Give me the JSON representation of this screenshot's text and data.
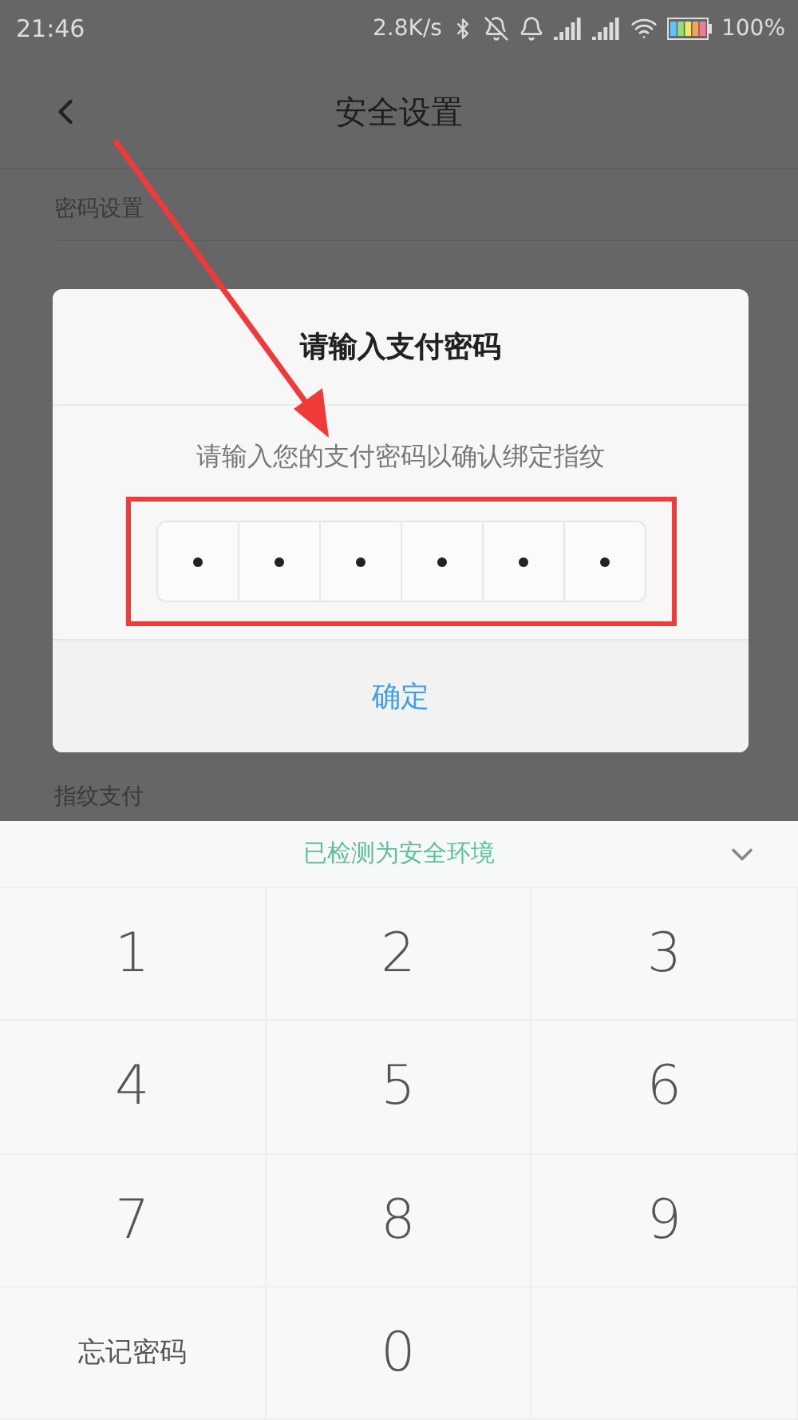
{
  "status_bar": {
    "time": "21:46",
    "speed": "2.8K/s",
    "battery": "100%"
  },
  "header": {
    "title": "安全设置"
  },
  "page": {
    "section": "密码设置",
    "section_2": "指纹支付"
  },
  "dialog": {
    "title": "请输入支付密码",
    "message": "请输入您的支付密码以确认绑定指纹",
    "pin": [
      {
        "filled": true
      },
      {
        "filled": true
      },
      {
        "filled": true
      },
      {
        "filled": true
      },
      {
        "filled": true
      },
      {
        "filled": true
      }
    ],
    "button": "确定"
  },
  "keypad": {
    "notice": "已检测为安全环境",
    "keys": [
      {
        "kind": "digit",
        "label": "1"
      },
      {
        "kind": "digit",
        "label": "2"
      },
      {
        "kind": "digit",
        "label": "3"
      },
      {
        "kind": "digit",
        "label": "4"
      },
      {
        "kind": "digit",
        "label": "5"
      },
      {
        "kind": "digit",
        "label": "6"
      },
      {
        "kind": "digit",
        "label": "7"
      },
      {
        "kind": "digit",
        "label": "8"
      },
      {
        "kind": "digit",
        "label": "9"
      },
      {
        "kind": "text",
        "label": "忘记密码"
      },
      {
        "kind": "digit",
        "label": "0"
      }
    ]
  }
}
